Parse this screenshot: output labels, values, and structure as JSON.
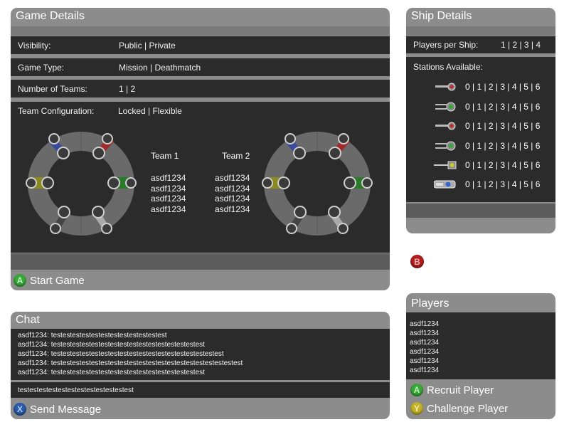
{
  "game_details": {
    "title": "Game Details",
    "visibility_label": "Visibility:",
    "visibility_value": "Public | Private",
    "game_type_label": "Game Type:",
    "game_type_value": "Mission | Deathmatch",
    "teams_label": "Number of Teams:",
    "teams_value": "1 | 2",
    "team_config_label": "Team Configuration:",
    "team_config_value": "Locked | Flexible",
    "team1": {
      "title": "Team 1",
      "members": [
        "asdf1234",
        "asdf1234",
        "asdf1234",
        "asdf1234"
      ]
    },
    "team2": {
      "title": "Team 2",
      "members": [
        "asdf1234",
        "asdf1234",
        "asdf1234",
        "asdf1234"
      ]
    },
    "start_button": {
      "glyph": "A",
      "label": "Start Game"
    }
  },
  "ship_details": {
    "title": "Ship Details",
    "players_label": "Players per Ship:",
    "players_value": "1 | 2 | 3 | 4",
    "stations_label": "Stations Available:",
    "stations": [
      {
        "icon": "red-turret-icon",
        "value": "0 | 1 | 2 | 3 | 4 | 5 | 6"
      },
      {
        "icon": "green-twin-turret-icon",
        "value": "0 | 1 | 2 | 3 | 4 | 5 | 6"
      },
      {
        "icon": "red-turret-icon",
        "value": "0 | 1 | 2 | 3 | 4 | 5 | 6"
      },
      {
        "icon": "green-twin-turret-icon",
        "value": "0 | 1 | 2 | 3 | 4 | 5 | 6"
      },
      {
        "icon": "yellow-long-turret-icon",
        "value": "0 | 1 | 2 | 3 | 4 | 5 | 6"
      },
      {
        "icon": "blue-pilot-station-icon",
        "value": "0 | 1 | 2 | 3 | 4 | 5 | 6"
      }
    ]
  },
  "b_button": {
    "glyph": "B"
  },
  "chat": {
    "title": "Chat",
    "messages": [
      "asdf1234: testestestestestestestestestestestest",
      "asdf1234: testestestestestestestestestestestestestestestest",
      "asdf1234: testestestestestestestestestestestestestestestestestest",
      "asdf1234: testestestestestestestestestestestestestestestestestestestest",
      "asdf1234: testestestestestestestestestestestestestestestest"
    ],
    "input_value": "testestestestestestestestestestestest",
    "send_button": {
      "glyph": "X",
      "label": "Send Message"
    }
  },
  "players": {
    "title": "Players",
    "list": [
      "asdf1234",
      "asdf1234",
      "asdf1234",
      "asdf1234",
      "asdf1234",
      "asdf1234"
    ],
    "recruit_button": {
      "glyph": "A",
      "label": "Recruit Player"
    },
    "challenge_button": {
      "glyph": "Y",
      "label": "Challenge Player"
    }
  },
  "colors": {
    "panel": "#8c8c8c",
    "row": "#2b2b2b",
    "button_a": "#3aa83a",
    "button_x": "#2b5aa6",
    "button_y": "#c4b32a",
    "button_b": "#b11c1c"
  }
}
